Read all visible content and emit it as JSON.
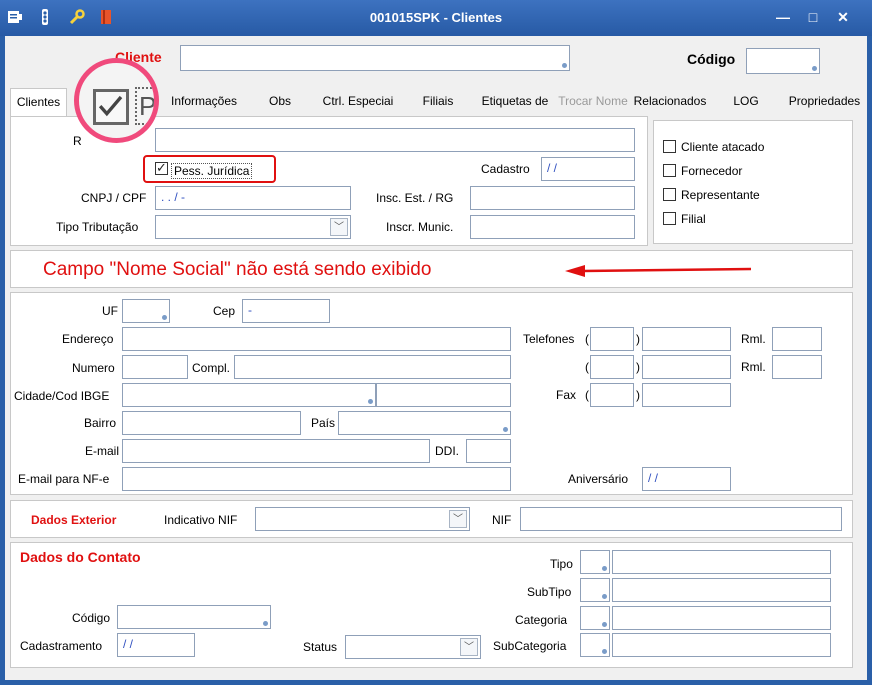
{
  "window": {
    "title": "001015SPK - Clientes",
    "controls": [
      "—",
      "□",
      "✕"
    ]
  },
  "header": {
    "cliente_label": "Cliente",
    "cliente_value": "",
    "codigo_label": "Código",
    "codigo_value": ""
  },
  "tabs": [
    {
      "label": "Clientes",
      "active": true
    },
    {
      "label": "Informações"
    },
    {
      "label": "Obs"
    },
    {
      "label": "Ctrl. Especiai"
    },
    {
      "label": "Filiais"
    },
    {
      "label": "Etiquetas de"
    },
    {
      "label": "Trocar Nome",
      "disabled": true
    },
    {
      "label": "Relacionados"
    },
    {
      "label": "LOG"
    },
    {
      "label": "Propriedades"
    }
  ],
  "main": {
    "razao_label": "R",
    "pess_juridica_label": "Pess. Jurídica",
    "cadastro_label": "Cadastro",
    "cadastro_value": " / /",
    "cnpj_label": "CNPJ / CPF",
    "cnpj_value": " .  .  /  -",
    "insc_est_label": "Insc. Est. / RG",
    "tipo_trib_label": "Tipo Tributação",
    "inscr_munic_label": "Inscr. Munic.",
    "flags": [
      "Cliente atacado",
      "Fornecedor",
      "Representante",
      "Filial"
    ]
  },
  "annotation": {
    "text": "Campo \"Nome Social\" não está sendo exibido",
    "zoom_label": "P"
  },
  "address": {
    "uf_label": "UF",
    "cep_label": "Cep",
    "cep_value": "  -",
    "endereco_label": "Endereço",
    "numero_label": "Numero",
    "compl_label": "Compl.",
    "cidade_label": "Cidade/Cod IBGE",
    "bairro_label": "Bairro",
    "pais_label": "País",
    "email_label": "E-mail",
    "ddi_label": "DDI.",
    "email_nfe_label": "E-mail para NF-e",
    "telefones_label": "Telefones",
    "rml_label": "Rml.",
    "fax_label": "Fax",
    "aniversario_label": "Aniversário",
    "aniversario_value": " / /"
  },
  "exterior": {
    "title": "Dados Exterior",
    "indicativo_label": "Indicativo NIF",
    "nif_label": "NIF"
  },
  "contato": {
    "title": "Dados do Contato",
    "codigo_label": "Código",
    "cadastramento_label": "Cadastramento",
    "cadastramento_value": " / /",
    "status_label": "Status",
    "tipo_label": "Tipo",
    "subtipo_label": "SubTipo",
    "categoria_label": "Categoria",
    "subcategoria_label": "SubCategoria"
  },
  "colors": {
    "titlebar": "#2a5fa8",
    "accent_red": "#e01010",
    "highlight_pink": "#f04a7c"
  }
}
